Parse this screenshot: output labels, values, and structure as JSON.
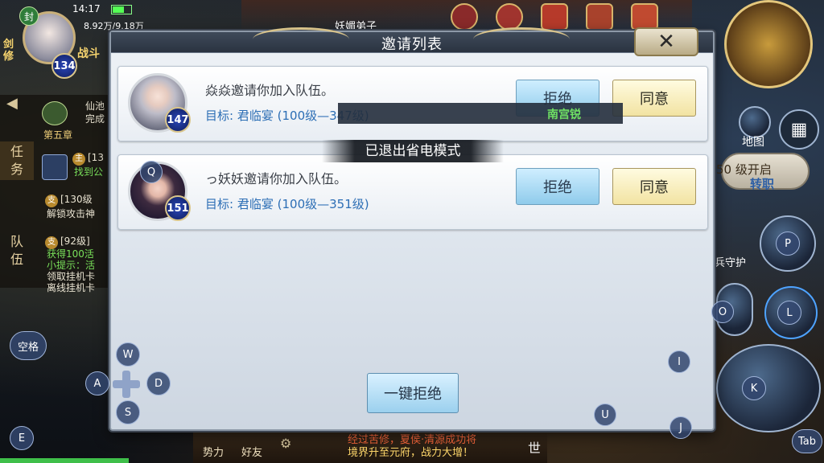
{
  "status_bar": {
    "time": "14:17",
    "power_line": "8.92万/9.18万"
  },
  "player": {
    "seal_label": "封",
    "role_label": "剑修",
    "level": "134",
    "team_label": "战斗"
  },
  "side_panel": {
    "tab_task": "任务",
    "tab_team": "队伍",
    "chapter": "第五章",
    "lines": [
      {
        "tag": "主",
        "text": "[13",
        "sub": "找到公"
      },
      {
        "tag": "支",
        "text": "[130级",
        "sub": "解锁攻击神"
      },
      {
        "tag": "支",
        "text": "[92级]",
        "sub": "获得100活"
      },
      {
        "tag": "",
        "text": "小提示：活",
        "sub": "领取挂机卡"
      },
      {
        "tag": "",
        "text": "离线挂机卡",
        "sub": ""
      }
    ],
    "xianchi": "仙池",
    "wancheng": "完成"
  },
  "top_hud": {
    "notice_title": "妖媚弟子"
  },
  "right_hud": {
    "map_label": "地图",
    "unlock_text": "50 级开启",
    "transfer_label": "转职",
    "guard_label": "兵守护"
  },
  "bottom_hud": {
    "shili": "势力",
    "haoyou": "好友",
    "news_line1": "经过苦修，夏侯·清源成功将",
    "news_line2": "境界升至元府，战力大增！",
    "world_label": "世"
  },
  "overlay_keys": {
    "space": "空格",
    "w": "W",
    "a": "A",
    "s": "S",
    "d": "D",
    "p": "P",
    "o": "O",
    "l": "L",
    "i": "I",
    "k": "K",
    "u": "U",
    "j": "J",
    "e": "E",
    "q": "Q",
    "tab": "Tab"
  },
  "modal": {
    "title": "邀请列表",
    "close_glyph": "✕",
    "invites": [
      {
        "inviter_text": "焱焱邀请你加入队伍。",
        "target_label": "目标:",
        "target_value": "君临宴",
        "range": "(100级—347级)",
        "level": "147",
        "reject": "拒绝",
        "accept": "同意"
      },
      {
        "inviter_text": "っ妖妖邀请你加入队伍。",
        "target_label": "目标:",
        "target_value": "君临宴",
        "range": "(100级—351级)",
        "level": "151",
        "reject": "拒绝",
        "accept": "同意"
      }
    ],
    "reject_all": "一键拒绝"
  },
  "toast": {
    "text": "已退出省电模式"
  },
  "banner": {
    "text": "南宫锐"
  }
}
